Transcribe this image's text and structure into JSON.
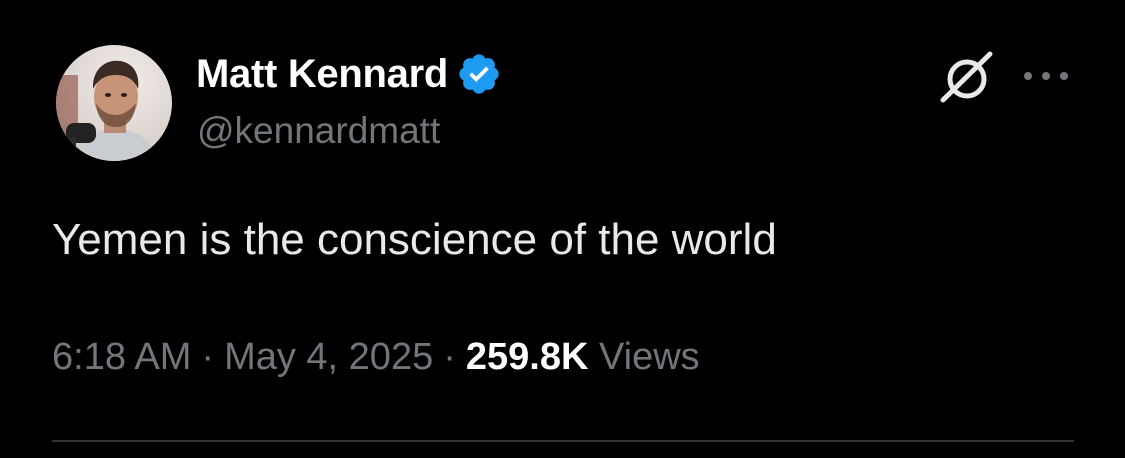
{
  "tweet": {
    "author": {
      "display_name": "Matt Kennard",
      "handle": "@kennardmatt",
      "verified": true,
      "avatar_icon": "profile-photo"
    },
    "text": "Yemen is the conscience of the world",
    "meta": {
      "time": "6:18 AM",
      "separator": "·",
      "date": "May 4, 2025",
      "views_count": "259.8K",
      "views_label": "Views"
    },
    "actions": {
      "grok_icon": "grok-icon",
      "more_icon": "more-options-icon"
    }
  },
  "colors": {
    "background": "#000000",
    "primary_text": "#e7e9ea",
    "secondary_text": "#71767b",
    "verified_badge": "#1d9bf0",
    "divider": "#2f3336"
  }
}
